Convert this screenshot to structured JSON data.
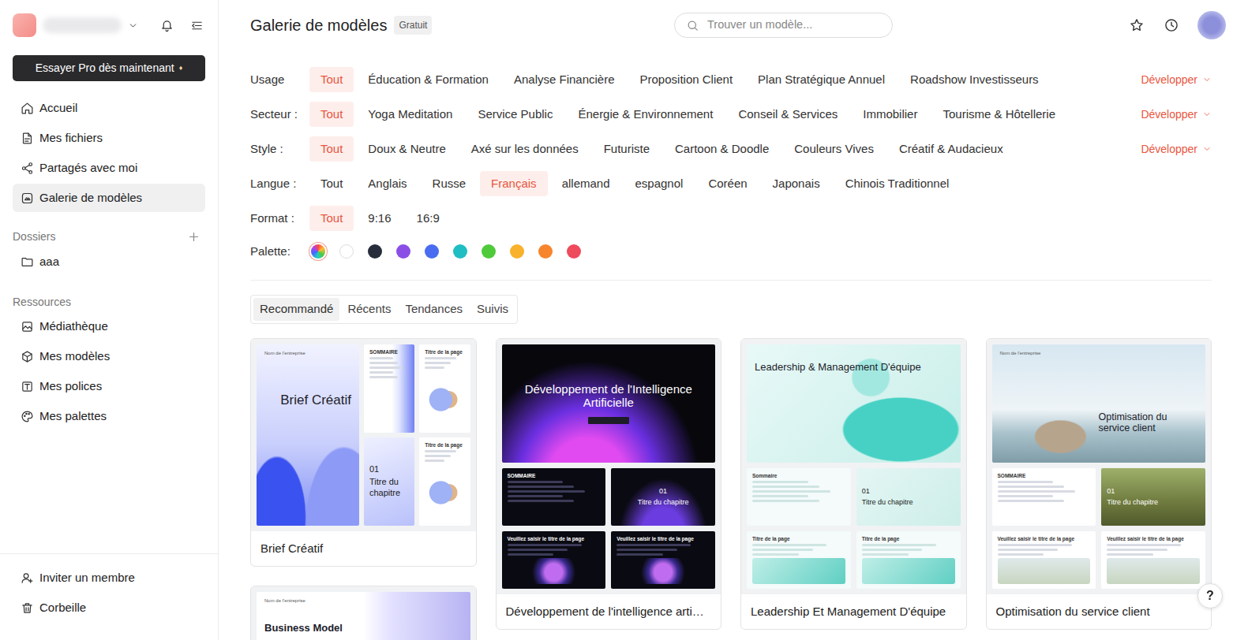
{
  "sidebar": {
    "pro_button": "Essayer Pro dès maintenant",
    "pro_icon": "♦",
    "nav": [
      {
        "label": "Accueil",
        "kind": "home",
        "selected": false
      },
      {
        "label": "Mes fichiers",
        "kind": "file",
        "selected": false
      },
      {
        "label": "Partagés avec moi",
        "kind": "share",
        "selected": false
      },
      {
        "label": "Galerie de modèles",
        "kind": "gallery",
        "selected": true
      }
    ],
    "folders": {
      "title": "Dossiers",
      "items": [
        {
          "label": "aaa",
          "kind": "folder"
        }
      ]
    },
    "resources": {
      "title": "Ressources",
      "items": [
        {
          "label": "Médiathèque",
          "kind": "media"
        },
        {
          "label": "Mes modèles",
          "kind": "cube"
        },
        {
          "label": "Mes polices",
          "kind": "font"
        },
        {
          "label": "Mes palettes",
          "kind": "palette"
        }
      ]
    },
    "footer": [
      {
        "label": "Inviter un membre",
        "kind": "invite"
      },
      {
        "label": "Corbeille",
        "kind": "trash"
      }
    ]
  },
  "header": {
    "title": "Galerie de modèles",
    "badge": "Gratuit"
  },
  "search": {
    "placeholder": "Trouver un modèle..."
  },
  "filters": [
    {
      "label": "Usage",
      "expand": "Développer",
      "options": [
        {
          "label": "Tout",
          "selected": true
        },
        {
          "label": "Éducation & Formation",
          "selected": false
        },
        {
          "label": "Analyse Financière",
          "selected": false
        },
        {
          "label": "Proposition Client",
          "selected": false
        },
        {
          "label": "Plan Stratégique Annuel",
          "selected": false
        },
        {
          "label": "Roadshow Investisseurs",
          "selected": false
        }
      ]
    },
    {
      "label": "Secteur :",
      "expand": "Développer",
      "options": [
        {
          "label": "Tout",
          "selected": true
        },
        {
          "label": "Yoga Meditation",
          "selected": false
        },
        {
          "label": "Service Public",
          "selected": false
        },
        {
          "label": "Énergie & Environnement",
          "selected": false
        },
        {
          "label": "Conseil & Services",
          "selected": false
        },
        {
          "label": "Immobilier",
          "selected": false
        },
        {
          "label": "Tourisme & Hôtellerie",
          "selected": false
        }
      ]
    },
    {
      "label": "Style :",
      "expand": "Développer",
      "options": [
        {
          "label": "Tout",
          "selected": true
        },
        {
          "label": "Doux & Neutre",
          "selected": false
        },
        {
          "label": "Axé sur les données",
          "selected": false
        },
        {
          "label": "Futuriste",
          "selected": false
        },
        {
          "label": "Cartoon & Doodle",
          "selected": false
        },
        {
          "label": "Couleurs Vives",
          "selected": false
        },
        {
          "label": "Créatif & Audacieux",
          "selected": false
        }
      ]
    },
    {
      "label": "Langue :",
      "options": [
        {
          "label": "Tout",
          "selected": false
        },
        {
          "label": "Anglais",
          "selected": false
        },
        {
          "label": "Russe",
          "selected": false
        },
        {
          "label": "Français",
          "selected": true
        },
        {
          "label": "allemand",
          "selected": false
        },
        {
          "label": "espagnol",
          "selected": false
        },
        {
          "label": "Coréen",
          "selected": false
        },
        {
          "label": "Japonais",
          "selected": false
        },
        {
          "label": "Chinois Traditionnel",
          "selected": false
        }
      ]
    },
    {
      "label": "Format :",
      "options": [
        {
          "label": "Tout",
          "selected": true
        },
        {
          "label": "9:16",
          "selected": false
        },
        {
          "label": "16:9",
          "selected": false
        }
      ]
    }
  ],
  "palette": {
    "label": "Palette:",
    "swatches": [
      {
        "kind": "rainbow",
        "selected": true
      },
      {
        "kind": "solid",
        "color": "#ffffff",
        "selected": false
      },
      {
        "kind": "solid",
        "color": "#272d3b",
        "selected": false
      },
      {
        "kind": "solid",
        "color": "#8b4fe6",
        "selected": false
      },
      {
        "kind": "solid",
        "color": "#4a6cf0",
        "selected": false
      },
      {
        "kind": "solid",
        "color": "#1fbec2",
        "selected": false
      },
      {
        "kind": "solid",
        "color": "#4fca3b",
        "selected": false
      },
      {
        "kind": "solid",
        "color": "#f8b22b",
        "selected": false
      },
      {
        "kind": "solid",
        "color": "#f7852d",
        "selected": false
      },
      {
        "kind": "solid",
        "color": "#ee4b5d",
        "selected": false
      }
    ]
  },
  "tabs": [
    {
      "label": "Recommandé",
      "selected": true
    },
    {
      "label": "Récents",
      "selected": false
    },
    {
      "label": "Tendances",
      "selected": false
    },
    {
      "label": "Suivis",
      "selected": false
    }
  ],
  "cards": [
    {
      "title": "Brief Créatif",
      "kind": "portrait",
      "look": "blue",
      "cover": {
        "caption": "Nom de l'entreprise",
        "title": "Brief Créatif"
      },
      "pages": [
        {
          "kind": "toc",
          "heading": "SOMMAIRE"
        },
        {
          "kind": "content",
          "heading": "Titre de la page"
        },
        {
          "kind": "chapter",
          "number": "01",
          "heading": "Titre du chapitre"
        },
        {
          "kind": "content",
          "heading": "Titre de la page"
        }
      ]
    },
    {
      "title": "Développement de l'intelligence arti…",
      "kind": "landscape",
      "look": "dark",
      "cover": {
        "title": "Développement de l'Intelligence Artificielle"
      },
      "pages": [
        {
          "kind": "toc",
          "heading": "SOMMAIRE"
        },
        {
          "kind": "chapter",
          "number": "01",
          "heading": "Titre du chapitre"
        },
        {
          "kind": "content",
          "heading": "Veuillez saisir le titre de la page"
        },
        {
          "kind": "content",
          "heading": "Veuillez saisir le titre de la page"
        }
      ]
    },
    {
      "title": "Leadership Et Management D'équipe",
      "kind": "landscape",
      "look": "mint",
      "cover": {
        "title": "Leadership & Management D'équipe"
      },
      "pages": [
        {
          "kind": "toc",
          "heading": "Sommaire"
        },
        {
          "kind": "chapter",
          "number": "01",
          "heading": "Titre du chapitre"
        },
        {
          "kind": "content",
          "heading": "Titre de la page"
        },
        {
          "kind": "content",
          "heading": "Titre de la page"
        }
      ]
    },
    {
      "title": "Optimisation du service client",
      "kind": "landscape",
      "look": "nature",
      "cover": {
        "caption": "Nom de l'entreprise",
        "title": "Optimisation du service client"
      },
      "pages": [
        {
          "kind": "toc",
          "heading": "SOMMAIRE"
        },
        {
          "kind": "chapter",
          "number": "01",
          "heading": "Titre du chapitre"
        },
        {
          "kind": "content",
          "heading": "Veuillez saisir le titre de la page"
        },
        {
          "kind": "content",
          "heading": "Veuillez saisir le titre de la page"
        }
      ]
    },
    {
      "kind": "landscape",
      "look": "glass",
      "cover": {
        "caption": "Nom de l'entreprise",
        "title": "Business Model"
      },
      "pages": []
    }
  ],
  "help": "?"
}
